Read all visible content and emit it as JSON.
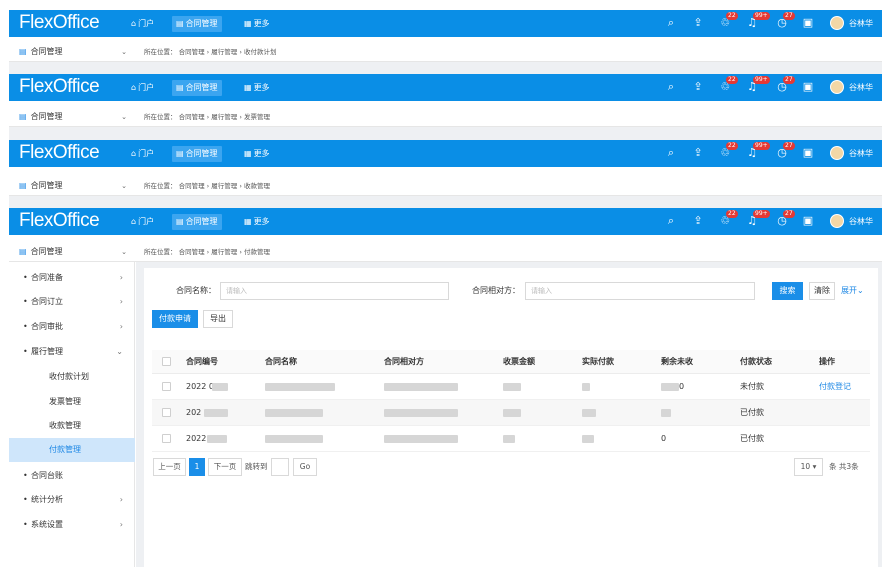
{
  "logo": "FlexOffice",
  "nav": [
    {
      "icon": "home-icon",
      "label": "门户"
    },
    {
      "icon": "contract-icon",
      "label": "合同管理"
    },
    {
      "icon": "grid-icon",
      "label": "更多"
    }
  ],
  "badges": {
    "tasks": "22",
    "notices": "99+",
    "reminders": "27"
  },
  "user": {
    "name": "谷林华"
  },
  "menu_title": "合同管理",
  "breadcrumbs": [
    "所在位置： 合同管理 › 履行管理 › 收付款计划",
    "所在位置： 合同管理 › 履行管理 › 发票管理",
    "所在位置： 合同管理 › 履行管理 › 收款管理",
    "所在位置： 合同管理 › 履行管理 › 付款管理"
  ],
  "sidebar": [
    {
      "label": "合同准备",
      "type": "group",
      "arrow": "›"
    },
    {
      "label": "合同订立",
      "type": "group",
      "arrow": "›"
    },
    {
      "label": "合同审批",
      "type": "group",
      "arrow": "›"
    },
    {
      "label": "履行管理",
      "type": "group",
      "arrow": "⌄"
    },
    {
      "label": "收付款计划",
      "type": "sub"
    },
    {
      "label": "发票管理",
      "type": "sub"
    },
    {
      "label": "收款管理",
      "type": "sub"
    },
    {
      "label": "付款管理",
      "type": "sub",
      "active": true
    },
    {
      "label": "合同台账",
      "type": "group",
      "arrow": ""
    },
    {
      "label": "统计分析",
      "type": "group",
      "arrow": "›"
    },
    {
      "label": "系统设置",
      "type": "group",
      "arrow": "›"
    }
  ],
  "filters": {
    "name_label": "合同名称：",
    "name_placeholder": "请输入",
    "party_label": "合同相对方：",
    "party_placeholder": "请输入",
    "search": "搜索",
    "clear": "清除",
    "expand": "展开⌄"
  },
  "actions": {
    "apply": "付款申请",
    "export": "导出"
  },
  "table": {
    "columns": [
      "合同编号",
      "合同名称",
      "合同相对方",
      "收票金额",
      "实际付款",
      "剩余未收",
      "付款状态",
      "操作"
    ],
    "rows": [
      {
        "code": "2022 0",
        "remain": "0",
        "status": "未付款",
        "op": "付款登记"
      },
      {
        "code": "202",
        "remain": "",
        "status": "已付款",
        "op": ""
      },
      {
        "code": "2022",
        "remain": "0",
        "status": "已付款",
        "op": ""
      }
    ]
  },
  "pagination": {
    "prev": "上一页",
    "current": "1",
    "next": "下一页",
    "jump": "跳转到",
    "go": "Go",
    "size": "10 ▾",
    "total": "条 共3条"
  }
}
